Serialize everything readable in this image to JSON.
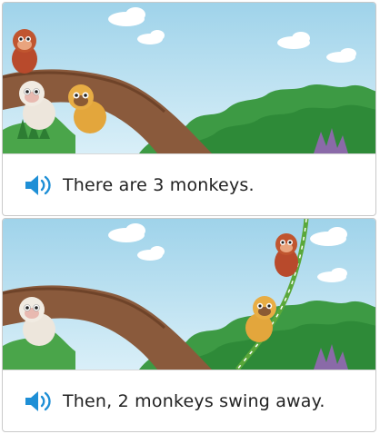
{
  "cards": [
    {
      "caption": "There are 3 monkeys."
    },
    {
      "caption": "Then, 2 monkeys swing away."
    }
  ],
  "icons": {
    "audio": "speaker-icon"
  },
  "colors": {
    "sky_top": "#9fd3ea",
    "sky_bottom": "#d6eef7",
    "grass": "#3a9a3a",
    "branch": "#8a5a3c",
    "speaker": "#1e8fd6",
    "text": "#222222"
  }
}
